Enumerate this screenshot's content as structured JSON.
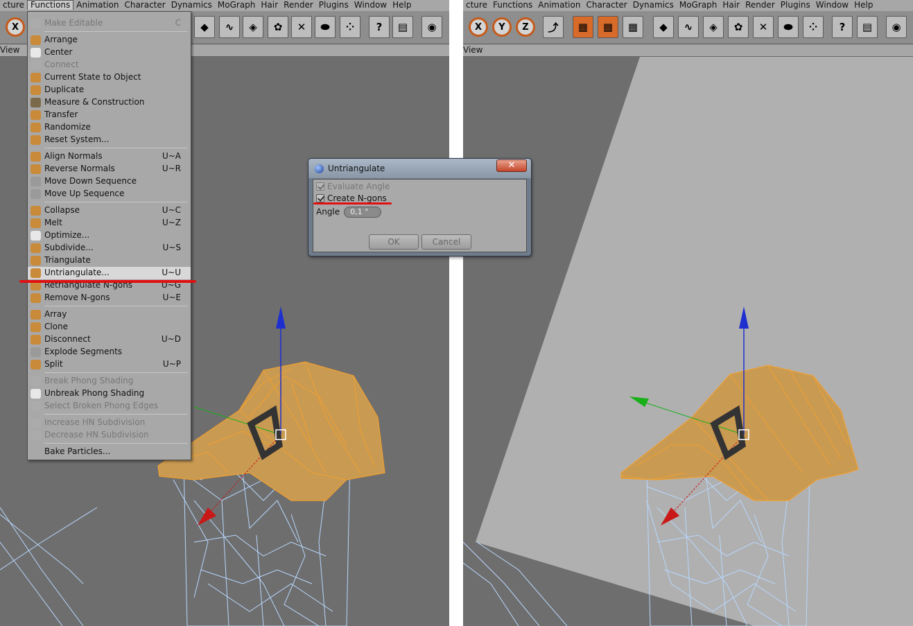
{
  "menubar": {
    "left": [
      "cture",
      "Functions",
      "Animation",
      "Character",
      "Dynamics",
      "MoGraph",
      "Hair",
      "Render",
      "Plugins",
      "Window",
      "Help"
    ],
    "right": [
      "cture",
      "Functions",
      "Animation",
      "Character",
      "Dynamics",
      "MoGraph",
      "Hair",
      "Render",
      "Plugins",
      "Window",
      "Help"
    ]
  },
  "toolbar": {
    "left_axis": "X",
    "right_axes": [
      "X",
      "Y",
      "Z"
    ],
    "icons": [
      "coordinate-system-icon",
      "render-view-icon",
      "render-region-icon",
      "render-settings-icon",
      "cube-icon",
      "spline-icon",
      "nurbs-icon",
      "array-icon",
      "deformer-icon",
      "scene-icon",
      "particle-icon",
      "help-cursor-icon",
      "layout-icon",
      "browser-icon"
    ]
  },
  "viewbar": {
    "left_label": "View",
    "right_label": "View"
  },
  "functions_menu": {
    "items": [
      {
        "label": "Make Editable",
        "shortcut": "C",
        "disabled": true,
        "icon_color": "#b0b0b0"
      },
      {
        "label": "Arrange",
        "shortcut": "",
        "disabled": false,
        "icon_color": "#c98a3a"
      },
      {
        "label": "Center",
        "shortcut": "",
        "disabled": false,
        "icon_color": "#e8e8e8"
      },
      {
        "label": "Connect",
        "shortcut": "",
        "disabled": true,
        "icon_color": "#b0b0b0"
      },
      {
        "label": "Current State to Object",
        "shortcut": "",
        "disabled": false,
        "icon_color": "#c98a3a"
      },
      {
        "label": "Duplicate",
        "shortcut": "",
        "disabled": false,
        "icon_color": "#c98a3a"
      },
      {
        "label": "Measure & Construction",
        "shortcut": "",
        "disabled": false,
        "icon_color": "#7a6a4a"
      },
      {
        "label": "Transfer",
        "shortcut": "",
        "disabled": false,
        "icon_color": "#c98a3a"
      },
      {
        "label": "Randomize",
        "shortcut": "",
        "disabled": false,
        "icon_color": "#c98a3a"
      },
      {
        "label": "Reset System...",
        "shortcut": "",
        "disabled": false,
        "icon_color": "#c98a3a"
      },
      {
        "label": "Align Normals",
        "shortcut": "U~A",
        "disabled": false,
        "icon_color": "#c98a3a"
      },
      {
        "label": "Reverse Normals",
        "shortcut": "U~R",
        "disabled": false,
        "icon_color": "#c98a3a"
      },
      {
        "label": "Move Down Sequence",
        "shortcut": "",
        "disabled": false,
        "icon_color": "#9a9a9a"
      },
      {
        "label": "Move Up Sequence",
        "shortcut": "",
        "disabled": false,
        "icon_color": "#9a9a9a"
      },
      {
        "label": "Collapse",
        "shortcut": "U~C",
        "disabled": false,
        "icon_color": "#c98a3a"
      },
      {
        "label": "Melt",
        "shortcut": "U~Z",
        "disabled": false,
        "icon_color": "#c98a3a"
      },
      {
        "label": "Optimize...",
        "shortcut": "",
        "disabled": false,
        "icon_color": "#e8e8e8"
      },
      {
        "label": "Subdivide...",
        "shortcut": "U~S",
        "disabled": false,
        "icon_color": "#c98a3a"
      },
      {
        "label": "Triangulate",
        "shortcut": "",
        "disabled": false,
        "icon_color": "#c98a3a"
      },
      {
        "label": "Untriangulate...",
        "shortcut": "U~U",
        "disabled": false,
        "icon_color": "#c98a3a",
        "highlight": true
      },
      {
        "label": "Retriangulate N-gons",
        "shortcut": "U~G",
        "disabled": false,
        "icon_color": "#c98a3a"
      },
      {
        "label": "Remove N-gons",
        "shortcut": "U~E",
        "disabled": false,
        "icon_color": "#c98a3a"
      },
      {
        "label": "Array",
        "shortcut": "",
        "disabled": false,
        "icon_color": "#c98a3a"
      },
      {
        "label": "Clone",
        "shortcut": "",
        "disabled": false,
        "icon_color": "#c98a3a"
      },
      {
        "label": "Disconnect",
        "shortcut": "U~D",
        "disabled": false,
        "icon_color": "#c98a3a"
      },
      {
        "label": "Explode Segments",
        "shortcut": "",
        "disabled": false,
        "icon_color": "#9a9a9a"
      },
      {
        "label": "Split",
        "shortcut": "U~P",
        "disabled": false,
        "icon_color": "#c98a3a"
      },
      {
        "label": "Break Phong Shading",
        "shortcut": "",
        "disabled": true,
        "icon_color": "#b0b0b0"
      },
      {
        "label": "Unbreak Phong Shading",
        "shortcut": "",
        "disabled": false,
        "icon_color": "#e8e8e8"
      },
      {
        "label": "Select Broken Phong Edges",
        "shortcut": "",
        "disabled": true,
        "icon_color": "#b0b0b0"
      },
      {
        "label": "Increase HN Subdivision",
        "shortcut": "",
        "disabled": true,
        "icon_color": "#b0b0b0"
      },
      {
        "label": "Decrease HN Subdivision",
        "shortcut": "",
        "disabled": true,
        "icon_color": "#b0b0b0"
      },
      {
        "label": "Bake Particles...",
        "shortcut": "",
        "disabled": false,
        "icon_color": "#a8a8a8"
      }
    ]
  },
  "dialog": {
    "title": "Untriangulate",
    "close_label": "✕",
    "evaluate_angle_label": "Evaluate Angle",
    "create_ngons_label": "Create N-gons",
    "angle_label": "Angle",
    "angle_value": "0,1 °",
    "ok_label": "OK",
    "cancel_label": "Cancel"
  },
  "colors": {
    "viewport_bg": "#6e6e6e",
    "floor_plane": "#b0b0b0",
    "roof_fill": "#c99a52",
    "roof_edges": "#f0a030",
    "wire_edges": "#b8d8ff",
    "axis_y": "#1e2fd0",
    "axis_x": "#c81818",
    "axis_z": "#18b018",
    "highlight_underline": "#e01010"
  }
}
